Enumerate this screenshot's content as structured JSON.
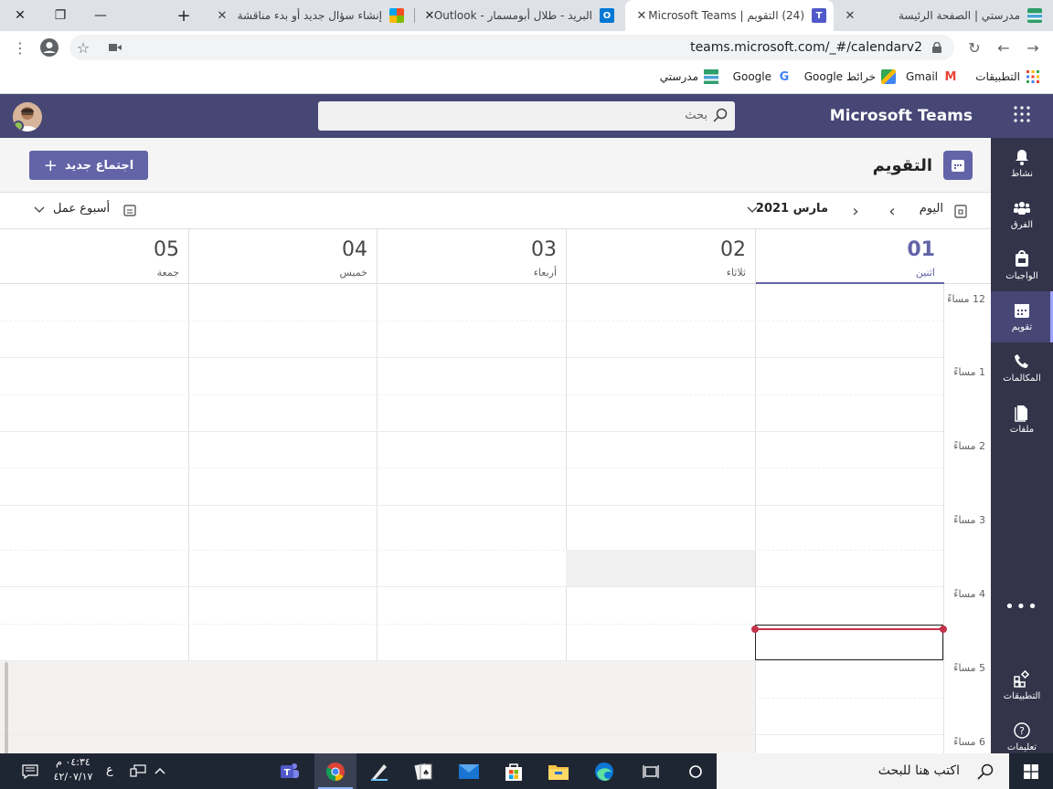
{
  "browser": {
    "tabs": [
      {
        "title": "مدرستي | الصفحة الرئيسة",
        "icon": "madrasati-icon",
        "active": false
      },
      {
        "title": "(24) التقويم | Microsoft Teams",
        "icon": "teams-icon",
        "active": true
      },
      {
        "title": "البريد - طلال أبومسمار - Outlook",
        "icon": "outlook-icon",
        "active": false
      },
      {
        "title": "إنشاء سؤال جديد أو بدء مناقشة",
        "icon": "microsoft-icon",
        "active": false
      }
    ],
    "url": "teams.microsoft.com/_#/calendarv2",
    "bookmarks": [
      {
        "label": "التطبيقات",
        "icon": "apps-grid-icon"
      },
      {
        "label": "Gmail",
        "icon": "gmail-icon"
      },
      {
        "label": "خرائط Google",
        "icon": "maps-icon"
      },
      {
        "label": "Google",
        "icon": "google-icon"
      },
      {
        "label": "مدرستي",
        "icon": "madrasati-icon"
      }
    ]
  },
  "teams": {
    "brand": "Microsoft Teams",
    "search_placeholder": "بحث",
    "rail": [
      {
        "label": "نشاط",
        "icon": "bell-icon",
        "active": false
      },
      {
        "label": "الفرق",
        "icon": "teams-people-icon",
        "active": false
      },
      {
        "label": "الواجبات",
        "icon": "assignments-icon",
        "active": false
      },
      {
        "label": "تقويم",
        "icon": "calendar-icon",
        "active": true
      },
      {
        "label": "المكالمات",
        "icon": "phone-icon",
        "active": false
      },
      {
        "label": "ملفات",
        "icon": "file-icon",
        "active": false
      }
    ],
    "rail_bottom": [
      {
        "label": "التطبيقات",
        "icon": "apps-icon"
      },
      {
        "label": "تعليمات",
        "icon": "help-icon"
      }
    ]
  },
  "calendar": {
    "title": "التقويم",
    "new_meeting": "اجتماع جديد",
    "today": "اليوم",
    "month": "مارس 2021",
    "view": "أسبوع عمل",
    "days": [
      {
        "num": "01",
        "name": "اثنين",
        "today": true
      },
      {
        "num": "02",
        "name": "ثلاثاء",
        "today": false
      },
      {
        "num": "03",
        "name": "أربعاء",
        "today": false
      },
      {
        "num": "04",
        "name": "خميس",
        "today": false
      },
      {
        "num": "05",
        "name": "جمعة",
        "today": false
      }
    ],
    "times": [
      "12 مساءً",
      "1 مساءً",
      "2 مساءً",
      "3 مساءً",
      "4 مساءً",
      "5 مساءً",
      "6 مساءً"
    ]
  },
  "taskbar": {
    "search_placeholder": "اكتب هنا للبحث",
    "time": "٠٤:٣٤ م",
    "date": "٤٢/٠٧/١٧",
    "lang": "ع"
  }
}
